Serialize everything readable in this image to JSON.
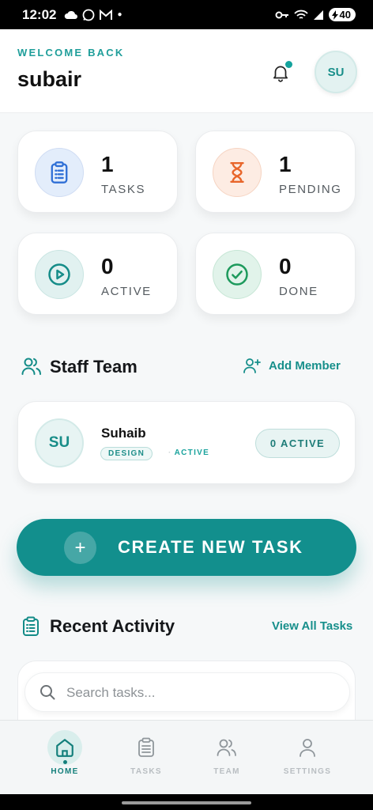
{
  "status_bar": {
    "time": "12:02",
    "battery": "40"
  },
  "header": {
    "welcome": "WELCOME BACK",
    "username": "subair",
    "avatar_initials": "SU"
  },
  "stats": [
    {
      "value": "1",
      "label": "TASKS",
      "icon": "clipboard-icon",
      "color": "#2f6fd6"
    },
    {
      "value": "1",
      "label": "PENDING",
      "icon": "hourglass-icon",
      "color": "#e8652a"
    },
    {
      "value": "0",
      "label": "ACTIVE",
      "icon": "play-circle-icon",
      "color": "#148c88"
    },
    {
      "value": "0",
      "label": "DONE",
      "icon": "check-circle-icon",
      "color": "#1d9a5c"
    }
  ],
  "staff_team": {
    "title": "Staff Team",
    "add_label": "Add Member",
    "members": [
      {
        "initials": "SU",
        "name": "Suhaib",
        "department": "DESIGN",
        "status": "ACTIVE",
        "active_count": "0 ACTIVE"
      }
    ]
  },
  "create_button": {
    "label": "CREATE NEW TASK",
    "icon": "+"
  },
  "recent_activity": {
    "title": "Recent Activity",
    "view_all": "View All Tasks",
    "search_placeholder": "Search tasks..."
  },
  "nav": [
    {
      "label": "HOME",
      "icon": "home-icon",
      "active": true
    },
    {
      "label": "TASKS",
      "icon": "clipboard-icon",
      "active": false
    },
    {
      "label": "TEAM",
      "icon": "team-icon",
      "active": false
    },
    {
      "label": "SETTINGS",
      "icon": "user-icon",
      "active": false
    }
  ],
  "colors": {
    "accent": "#128f8d",
    "background": "#f6f8f9"
  }
}
